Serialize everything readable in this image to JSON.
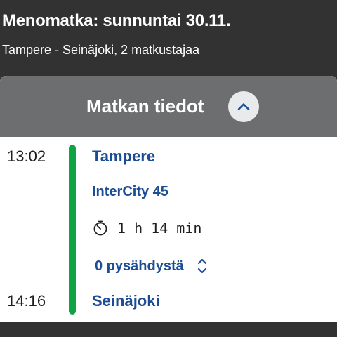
{
  "header": {
    "title": "Menomatka: sunnuntai 30.11.",
    "subtitle": "Tampere - Seinäjoki, 2 matkustajaa"
  },
  "details_card": {
    "title": "Matkan tiedot",
    "toggle_icon": "chevron-up-icon"
  },
  "journey": {
    "departure_time": "13:02",
    "departure_station": "Tampere",
    "train": "InterCity 45",
    "duration_icon": "timer-icon",
    "duration": "1 h 14 min",
    "stops_label": "0 pysähdystä",
    "stops_icon": "expand-icon",
    "arrival_time": "14:16",
    "arrival_station": "Seinäjoki"
  },
  "colors": {
    "background": "#323232",
    "card_header": "#6d6e70",
    "route_line": "#10a346",
    "link": "#1c4d94"
  }
}
